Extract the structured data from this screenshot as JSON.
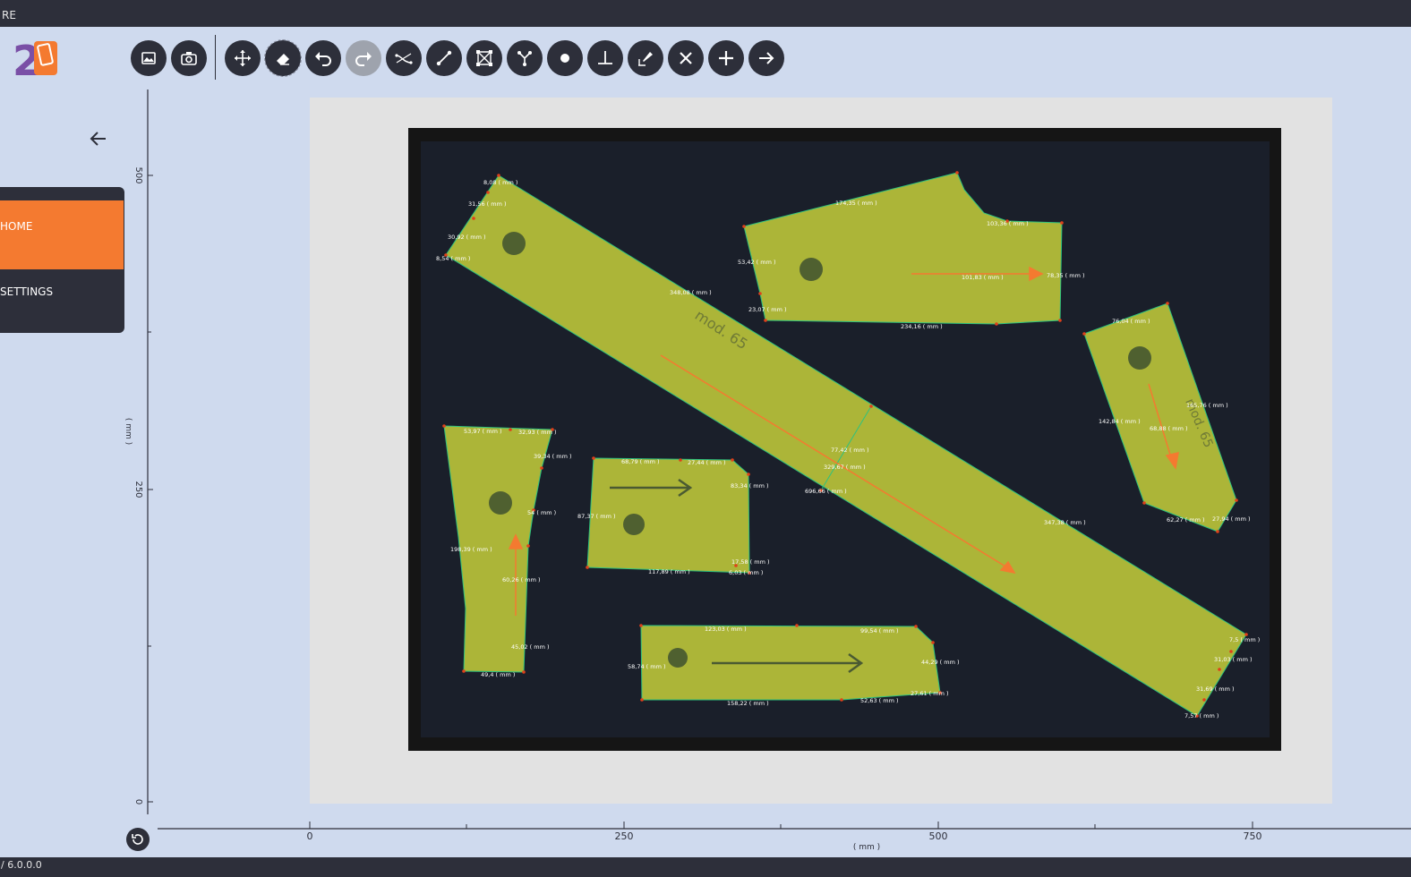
{
  "window": {
    "title": "RE",
    "version": "/ 6.0.0.0"
  },
  "logo": {
    "text": "2D",
    "icon": "phone-icon"
  },
  "toolbar": {
    "buttons": [
      {
        "name": "open-image-button",
        "icon": "image-icon"
      },
      {
        "name": "camera-button",
        "icon": "camera-icon"
      },
      {
        "name": "move-button",
        "icon": "move-arrows-icon"
      },
      {
        "name": "eraser-button",
        "icon": "eraser-icon",
        "state": "selected"
      },
      {
        "name": "undo-button",
        "icon": "undo-icon"
      },
      {
        "name": "redo-button",
        "icon": "redo-icon",
        "state": "disabled"
      },
      {
        "name": "curve-button",
        "icon": "curve-icon"
      },
      {
        "name": "line-button",
        "icon": "line-segment-icon"
      },
      {
        "name": "polygon-button",
        "icon": "polygon-nodes-icon"
      },
      {
        "name": "branch-button",
        "icon": "branch-nodes-icon"
      },
      {
        "name": "point-button",
        "icon": "dot-icon"
      },
      {
        "name": "perpendicular-button",
        "icon": "perpendicular-icon"
      },
      {
        "name": "edit-point-button",
        "icon": "pencil-point-icon"
      },
      {
        "name": "delete-button",
        "icon": "close-icon"
      },
      {
        "name": "add-button",
        "icon": "plus-icon"
      },
      {
        "name": "next-button",
        "icon": "arrow-right-icon"
      }
    ]
  },
  "sidebar": {
    "back_icon": "arrow-left-icon",
    "items": [
      {
        "label": "HOME",
        "active": true
      },
      {
        "label": "SETTINGS",
        "active": false
      }
    ]
  },
  "plot": {
    "x_axis": {
      "ticks": [
        "0",
        "250",
        "500",
        "750"
      ],
      "unit": "( mm )"
    },
    "y_axis": {
      "ticks": [
        "500",
        "250",
        "0"
      ],
      "unit": "( mm )"
    }
  },
  "colors": {
    "accent": "#f47a30",
    "dark": "#2d2f3a",
    "background": "#cfdaee",
    "piece_fill": "#b8c23a",
    "piece_edge": "#2ec27e",
    "point": "#e0401a"
  },
  "measurements": {
    "strip": [
      "8,08 ( mm )",
      "31,56 ( mm )",
      "30,92 ( mm )",
      "8,54 ( mm )",
      "348,08 ( mm )",
      "77,42 ( mm )",
      "329,67 ( mm )",
      "696,66 ( mm )",
      "347,38 ( mm )",
      "7,5 ( mm )",
      "31,03 ( mm )",
      "31,69 ( mm )",
      "7,57 ( mm )"
    ],
    "shoe_piece": [
      "174,35 ( mm )",
      "103,36 ( mm )",
      "53,42 ( mm )",
      "101,83 ( mm )",
      "78,35 ( mm )",
      "23,07 ( mm )",
      "234,16 ( mm )"
    ],
    "right_piece": [
      "76,04 ( mm )",
      "165,76 ( mm )",
      "142,84 ( mm )",
      "68,88 ( mm )",
      "62,27 ( mm )",
      "27,94 ( mm )"
    ],
    "left_piece": [
      "53,97 ( mm )",
      "32,93 ( mm )",
      "39,34 ( mm )",
      "54 ( mm )",
      "198,39 ( mm )",
      "60,26 ( mm )",
      "45,02 ( mm )",
      "49,4 ( mm )"
    ],
    "center_piece": [
      "68,79 ( mm )",
      "27,44 ( mm )",
      "83,34 ( mm )",
      "87,37 ( mm )",
      "17,58 ( mm )",
      "117,89 ( mm )",
      "6,03 ( mm )"
    ],
    "bottom_piece": [
      "123,03 ( mm )",
      "99,54 ( mm )",
      "58,74 ( mm )",
      "44,29 ( mm )",
      "27,61 ( mm )",
      "52,63 ( mm )",
      "158,22 ( mm )"
    ]
  },
  "pattern_text": "mod. 65",
  "reset_icon": "reset-icon"
}
